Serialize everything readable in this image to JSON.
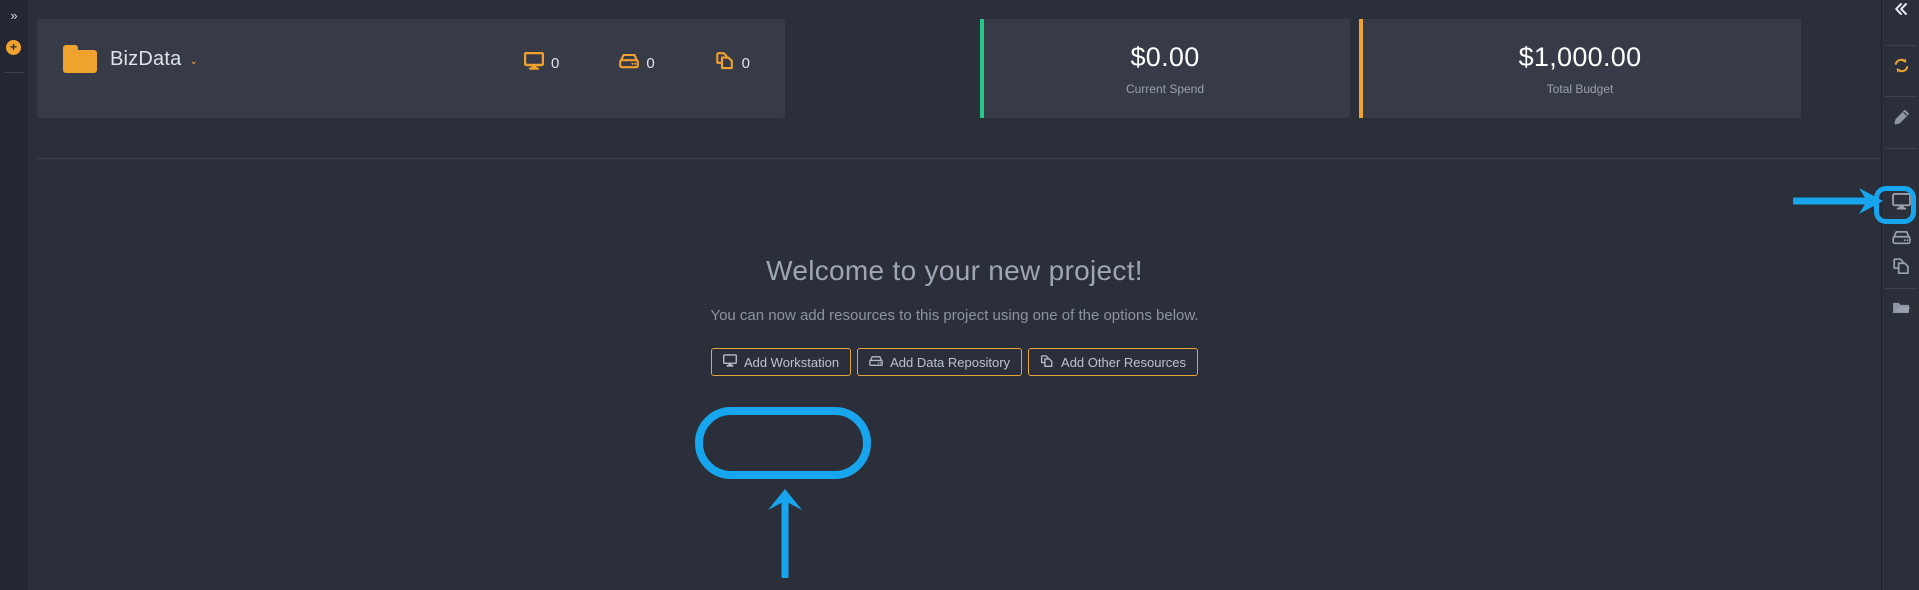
{
  "theme": {
    "bg": "#2b2f3a",
    "panel": "#373b47",
    "accent_orange": "#f0a22e",
    "accent_green": "#24c98a",
    "annotation_blue": "#17a6ee",
    "text_primary": "#dfe3ea",
    "text_muted": "#9aa1ae"
  },
  "left_rail": {
    "expand_label": "»",
    "add_label": "+"
  },
  "project_header": {
    "name": "BizData",
    "caret": "⌄",
    "counts": [
      {
        "icon": "monitor-icon",
        "value": "0"
      },
      {
        "icon": "drive-icon",
        "value": "0"
      },
      {
        "icon": "copy-icon",
        "value": "0"
      }
    ]
  },
  "stats": [
    {
      "value": "$0.00",
      "label": "Current Spend",
      "bar_color": "#24c98a"
    },
    {
      "value": "$1,000.00",
      "label": "Total Budget",
      "bar_color": "#f0a22e"
    }
  ],
  "welcome": {
    "title": "Welcome to your new project!",
    "subtitle": "You can now add resources to this project using one of the options below."
  },
  "resource_buttons": [
    {
      "icon": "monitor-icon",
      "label": "Add Workstation"
    },
    {
      "icon": "drive-icon",
      "label": "Add Data Repository"
    },
    {
      "icon": "copy-icon",
      "label": "Add Other Resources"
    }
  ],
  "right_rail": {
    "items": [
      {
        "icon": "collapse-left-icon",
        "name": "collapse-panel"
      },
      {
        "icon": "refresh-icon",
        "name": "refresh"
      },
      {
        "icon": "pencil-icon",
        "name": "edit"
      },
      {
        "icon": "monitor-icon",
        "name": "add-workstation"
      },
      {
        "icon": "drive-icon",
        "name": "add-data-repository"
      },
      {
        "icon": "copy-icon",
        "name": "add-other-resources"
      },
      {
        "icon": "folder-open-icon",
        "name": "browse-files"
      }
    ]
  },
  "annotations": {
    "ring_target": "Add Workstation",
    "arrow_up_target": "Add Workstation",
    "arrow_right_target": "add-workstation-rail-icon"
  }
}
